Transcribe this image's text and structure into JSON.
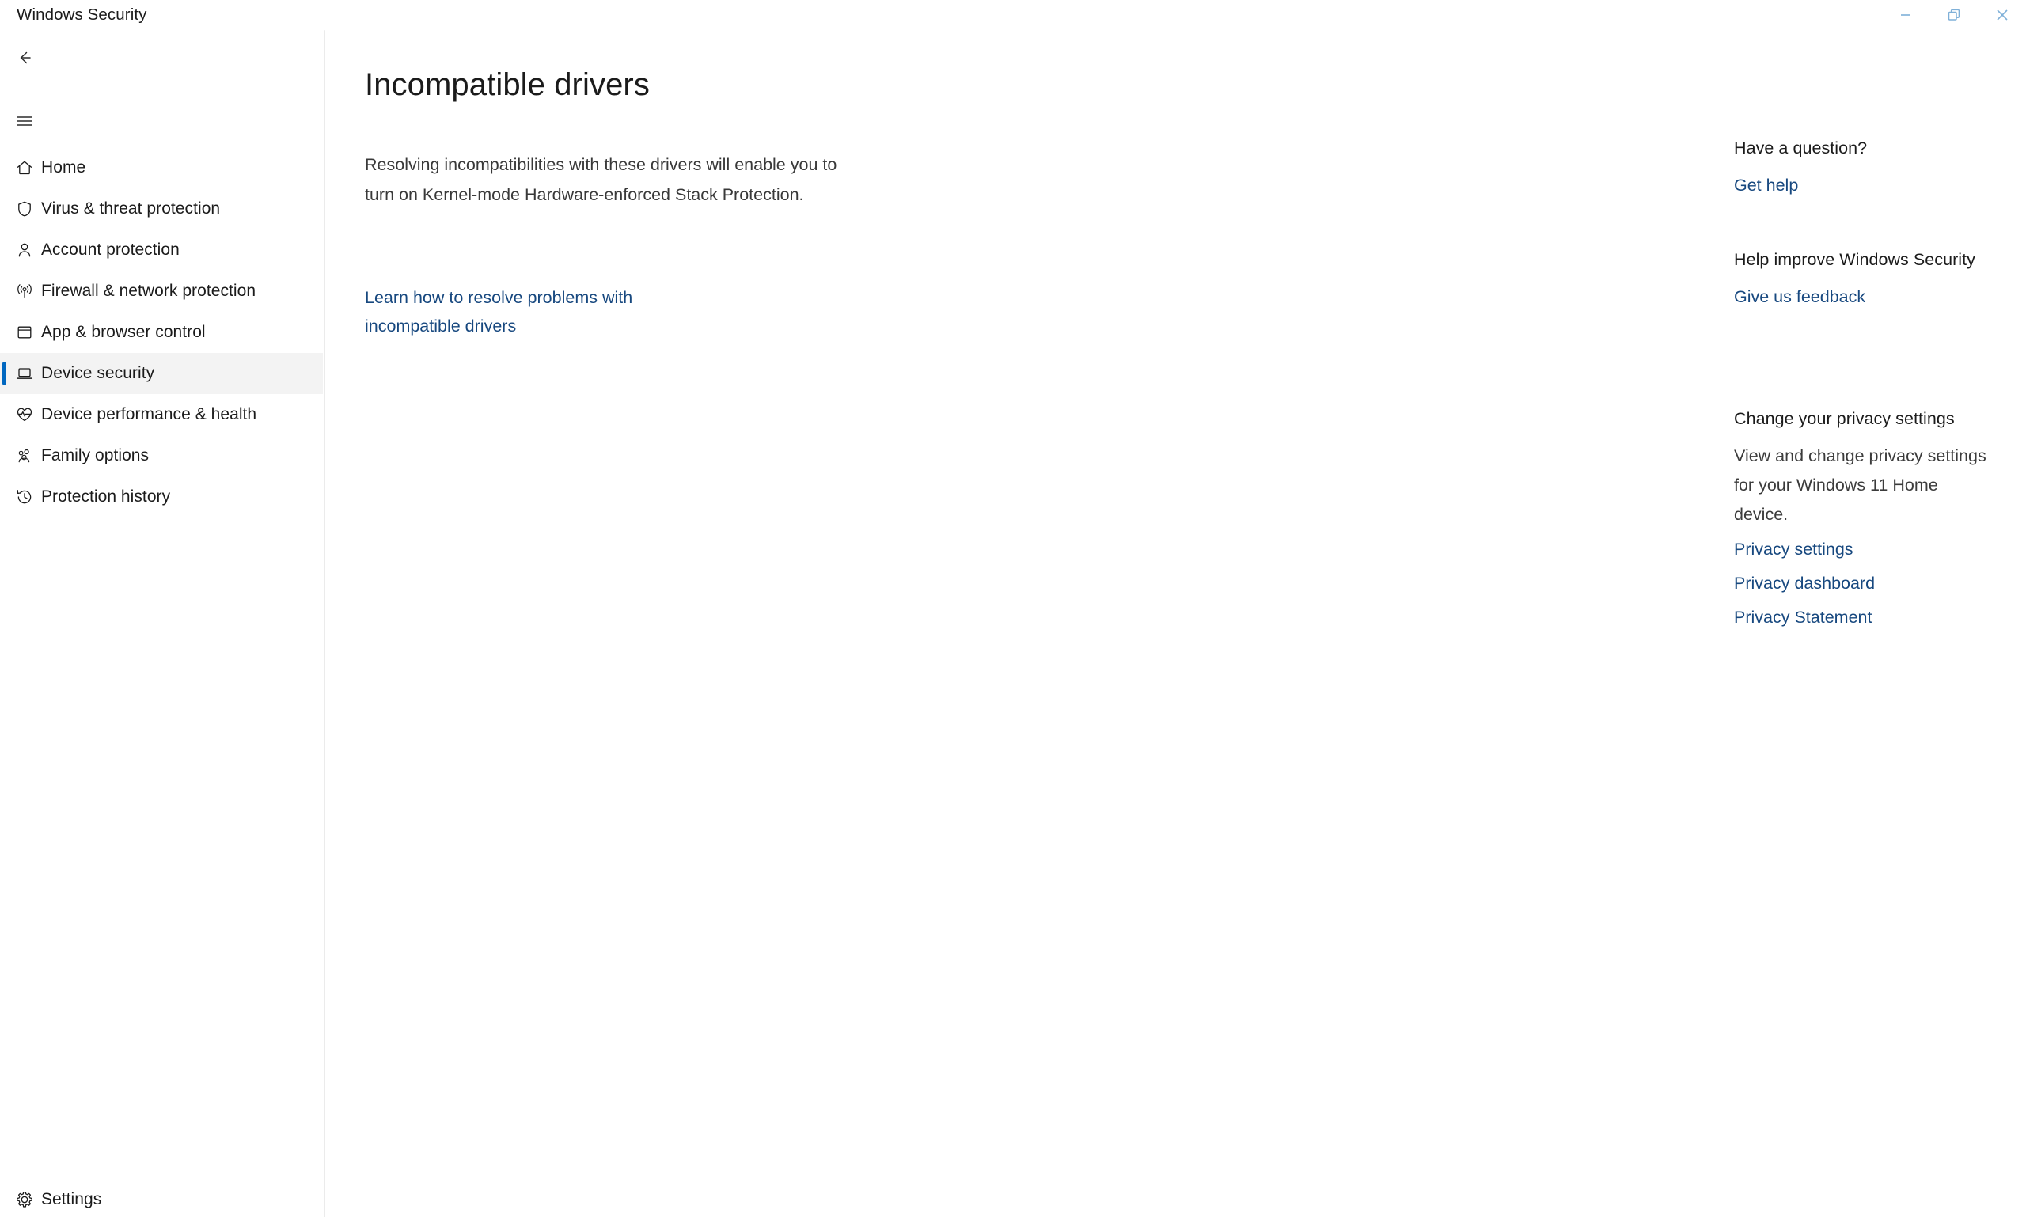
{
  "window": {
    "title": "Windows Security",
    "controls": [
      {
        "name": "minimize-button",
        "glyph": "minimize"
      },
      {
        "name": "maximize-button",
        "glyph": "restore"
      },
      {
        "name": "close-button",
        "glyph": "close"
      }
    ]
  },
  "sidebar": {
    "back_label": "Back",
    "menu_label": "Navigation menu",
    "items": [
      {
        "label": "Home",
        "icon": "home-icon",
        "selected": false
      },
      {
        "label": "Virus & threat protection",
        "icon": "shield-icon",
        "selected": false
      },
      {
        "label": "Account protection",
        "icon": "person-icon",
        "selected": false
      },
      {
        "label": "Firewall & network protection",
        "icon": "wireless-icon",
        "selected": false
      },
      {
        "label": "App & browser control",
        "icon": "window-icon",
        "selected": false
      },
      {
        "label": "Device security",
        "icon": "laptop-icon",
        "selected": true
      },
      {
        "label": "Device performance & health",
        "icon": "heart-pulse-icon",
        "selected": false
      },
      {
        "label": "Family options",
        "icon": "people-icon",
        "selected": false
      },
      {
        "label": "Protection history",
        "icon": "history-icon",
        "selected": false
      }
    ],
    "settings": {
      "label": "Settings",
      "icon": "gear-icon"
    }
  },
  "main": {
    "title": "Incompatible drivers",
    "description": "Resolving incompatibilities with these drivers will enable you to turn on Kernel-mode Hardware-enforced Stack Protection.",
    "learn_link": "Learn how to resolve problems with incompatible drivers"
  },
  "right_rail": {
    "help": {
      "heading": "Have a question?",
      "link": "Get help"
    },
    "improve": {
      "heading": "Help improve Windows Security",
      "link": "Give us feedback"
    },
    "privacy": {
      "heading": "Change your privacy settings",
      "body": "View and change privacy settings for your Windows 11 Home device.",
      "link_settings": "Privacy settings",
      "link_dashboard": "Privacy dashboard",
      "link_statement": "Privacy Statement"
    }
  },
  "colors": {
    "accent": "#0067c0",
    "link": "#17487f",
    "selected_bg": "#f3f3f3",
    "window_control": "#7fb0d8"
  }
}
